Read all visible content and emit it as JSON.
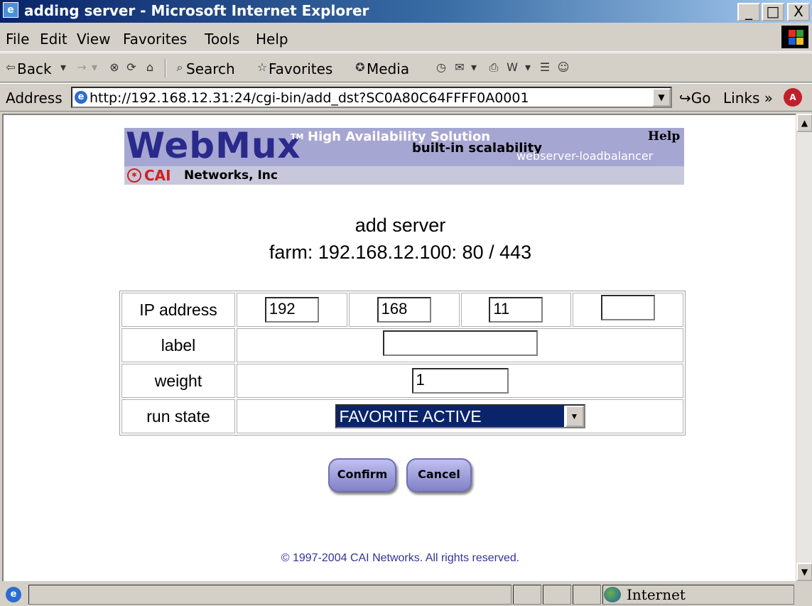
{
  "window": {
    "title": "adding server - Microsoft Internet Explorer",
    "controls": {
      "minimize": "_",
      "maximize": "□",
      "close": "X"
    }
  },
  "menubar": {
    "items": [
      {
        "label": "File"
      },
      {
        "label": "Edit"
      },
      {
        "label": "View"
      },
      {
        "label": "Favorites"
      },
      {
        "label": "Tools"
      },
      {
        "label": "Help"
      }
    ]
  },
  "toolbar": {
    "back": "Back",
    "search": "Search",
    "favorites": "Favorites",
    "media": "Media"
  },
  "addressbar": {
    "label": "Address",
    "url": "http://192.168.12.31:24/cgi-bin/add_dst?SC0A80C64FFFF0A0001",
    "go": "Go",
    "links": "Links"
  },
  "banner": {
    "brand": "WebMux",
    "tm": "TM",
    "tagline1": "High Availability Solution",
    "tagline2": "built-in scalability",
    "tagline3": "webserver-loadbalancer",
    "help": "Help",
    "company_highlight": "CAI",
    "company_rest": "Networks, Inc"
  },
  "page": {
    "title": "add server",
    "farm": "farm: 192.168.12.100: 80 / 443"
  },
  "form": {
    "ip_label": "IP address",
    "ip_octets": [
      "192",
      "168",
      "11",
      ""
    ],
    "label_label": "label",
    "label_value": "",
    "weight_label": "weight",
    "weight_value": "1",
    "runstate_label": "run state",
    "runstate_value": "FAVORITE ACTIVE"
  },
  "buttons": {
    "confirm": "Confirm",
    "cancel": "Cancel"
  },
  "footer": {
    "copyright": "© 1997-2004 CAI Networks. All rights reserved."
  },
  "statusbar": {
    "zone": "Internet"
  },
  "colors": {
    "titlebar": "#0a246a",
    "banner": "#a6a6d2",
    "brand": "#2a2a8c",
    "company_red": "#d02020",
    "selection": "#0a246a",
    "button": "#8080c8"
  }
}
